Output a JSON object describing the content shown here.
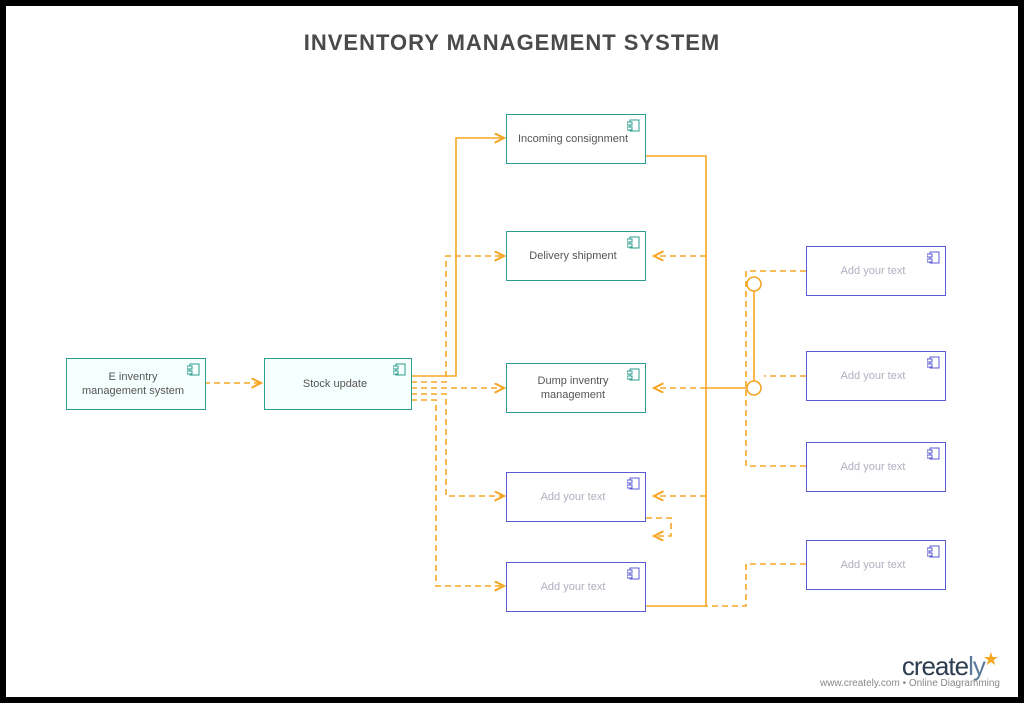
{
  "title": "INVENTORY MANAGEMENT SYSTEM",
  "nodes": {
    "n1": "E inventry management system",
    "n2": "Stock update",
    "n3": "Incoming consignment",
    "n4": "Delivery shipment",
    "n5": "Dump inventry management",
    "n6": "Add your text",
    "n7": "Add your text",
    "n8": "Add your text",
    "n9": "Add your text",
    "n10": "Add your text",
    "n11": "Add your text"
  },
  "footer": {
    "brand_a": "create",
    "brand_b": "ly",
    "tagline": "www.creately.com • Online Diagramming"
  },
  "colors": {
    "teal": "#2a9d8f",
    "purple": "#5b5bd6",
    "orange": "#f5a623"
  }
}
